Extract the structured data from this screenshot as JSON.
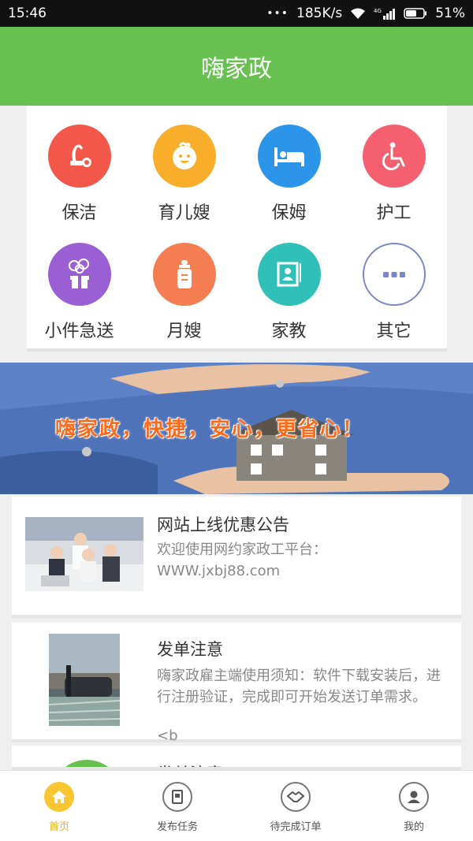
{
  "status": {
    "time": "15:46",
    "dots": "•••",
    "speed": "185K/s",
    "net": "4G",
    "battery": "51%"
  },
  "header": {
    "title": "嗨家政"
  },
  "services": [
    {
      "label": "保洁",
      "icon": "vacuum-icon",
      "color": "#f2574a"
    },
    {
      "label": "育儿嫂",
      "icon": "baby-icon",
      "color": "#f9ae2b"
    },
    {
      "label": "保姆",
      "icon": "bed-icon",
      "color": "#2d95e9"
    },
    {
      "label": "护工",
      "icon": "wheelchair-icon",
      "color": "#f4606f"
    },
    {
      "label": "小件急送",
      "icon": "gift-icon",
      "color": "#9b5fd4"
    },
    {
      "label": "月嫂",
      "icon": "bottle-icon",
      "color": "#f47e52"
    },
    {
      "label": "家教",
      "icon": "teacher-board-icon",
      "color": "#2fc1b8"
    },
    {
      "label": "其它",
      "icon": "more-icon",
      "color": "#7a86c9"
    }
  ],
  "banner": {
    "slogan": "嗨家政，快捷，安心，更省心！"
  },
  "news": [
    {
      "title": "网站上线优惠公告",
      "desc": "欢迎使用网约家政工平台：WWW.jxbj88.com"
    },
    {
      "title": "发单注意",
      "desc": "嗨家政雇主端使用须知：软件下载安装后，进行注册验证，完成即可开始发送订单需求。",
      "extra": "<b"
    },
    {
      "title": "发单注意"
    }
  ],
  "tabs": [
    {
      "label": "首页",
      "icon": "home-icon",
      "active": true
    },
    {
      "label": "发布任务",
      "icon": "notebook-icon",
      "active": false
    },
    {
      "label": "待完成订单",
      "icon": "handshake-icon",
      "active": false
    },
    {
      "label": "我的",
      "icon": "user-icon",
      "active": false
    }
  ],
  "colors": {
    "header": "#67c04f",
    "tab_active": "#f0b21a"
  }
}
